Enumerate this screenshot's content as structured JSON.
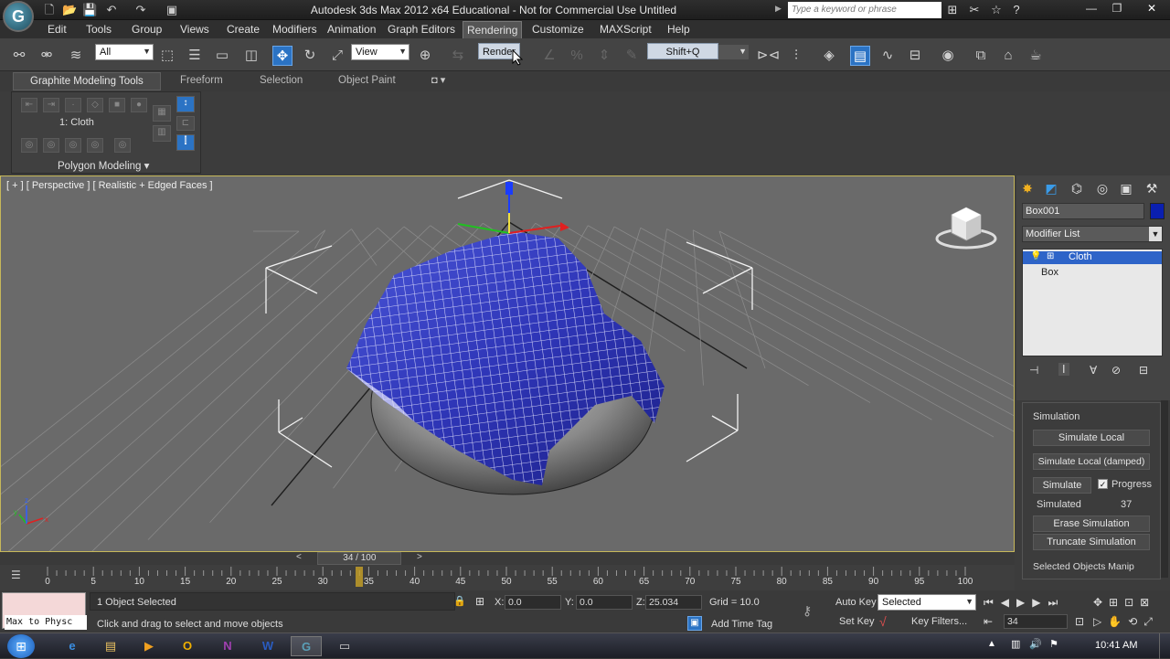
{
  "app": {
    "logo_glyph": "G",
    "window_title": "Autodesk 3ds Max  2012 x64   Educational - Not for Commercial Use   Untitled",
    "search_placeholder": "Type a keyword or phrase",
    "win_minimize": "—",
    "win_restore": "❐",
    "win_close": "✕"
  },
  "quick_access": [
    {
      "name": "new-file-icon",
      "glyph": "🗋"
    },
    {
      "name": "open-file-icon",
      "glyph": "📂"
    },
    {
      "name": "save-icon",
      "glyph": "💾"
    },
    {
      "name": "undo-icon",
      "glyph": "↶"
    },
    {
      "name": "redo-icon",
      "glyph": "↷"
    },
    {
      "name": "project-folder-icon",
      "glyph": "▣"
    }
  ],
  "title_icons": [
    {
      "name": "binoculars-icon",
      "glyph": "⊞"
    },
    {
      "name": "tools-icon",
      "glyph": "✂"
    },
    {
      "name": "star-icon",
      "glyph": "☆"
    },
    {
      "name": "help-icon",
      "glyph": "?"
    }
  ],
  "menu": [
    "Edit",
    "Tools",
    "Group",
    "Views",
    "Create",
    "Modifiers",
    "Animation",
    "Graph Editors",
    "Rendering",
    "Customize",
    "MAXScript",
    "Help"
  ],
  "toolbar": {
    "selection_filter": "All",
    "reference_coord": "View",
    "render_tooltip": "Render",
    "shortcut_tooltip": "Shift+Q"
  },
  "ribbon": {
    "tabs": [
      "Graphite Modeling Tools",
      "Freeform",
      "Selection",
      "Object Paint"
    ],
    "object_label": "1: Cloth",
    "panel_title": "Polygon Modeling"
  },
  "viewport": {
    "label": "[ + ] [ Perspective ] [ Realistic + Edged Faces ]",
    "axis_x": "x",
    "axis_y": "y",
    "axis_z": "z"
  },
  "command_panel": {
    "object_name": "Box001",
    "object_color": "#0a1fb0",
    "modifier_list": "Modifier List",
    "stack": [
      "Cloth",
      "Box"
    ],
    "rollout_title": "Simulation",
    "buttons": {
      "simulate_local": "Simulate Local",
      "simulate_local_damped": "Simulate Local (damped)",
      "simulate": "Simulate",
      "erase_simulation": "Erase Simulation",
      "truncate_simulation": "Truncate Simulation"
    },
    "progress_label": "Progress",
    "progress_checked": true,
    "simulated_label": "Simulated",
    "simulated_value": "37",
    "next_rollout": "Selected Objects Manip"
  },
  "timeline": {
    "frame_readout": "34 / 100",
    "current_frame": 34,
    "total_frames": 100,
    "ticks": [
      "0",
      "5",
      "10",
      "15",
      "20",
      "25",
      "30",
      "35",
      "40",
      "45",
      "50",
      "55",
      "60",
      "65",
      "70",
      "75",
      "80",
      "85",
      "90",
      "95",
      "100"
    ]
  },
  "status": {
    "listener_text": "Max to Physc",
    "selection": "1 Object Selected",
    "prompt": "Click and drag to select and move objects",
    "x_label": "X:",
    "x_value": "0.0",
    "y_label": "Y:",
    "y_value": "0.0",
    "z_label": "Z:",
    "z_value": "25.034",
    "grid": "Grid = 10.0",
    "add_time_tag": "Add Time Tag",
    "auto_key": "Auto Key",
    "set_key": "Set Key",
    "key_mode": "Selected",
    "key_filters": "Key Filters...",
    "frame_field": "34"
  },
  "taskbar": {
    "clock": "10:41 AM",
    "apps": [
      {
        "name": "internet-explorer-icon",
        "glyph": "e",
        "color": "#3a8de0"
      },
      {
        "name": "file-explorer-icon",
        "glyph": "▤",
        "color": "#e8c060"
      },
      {
        "name": "media-player-icon",
        "glyph": "▶",
        "color": "#f0a020"
      },
      {
        "name": "outlook-icon",
        "glyph": "O",
        "color": "#f0b000"
      },
      {
        "name": "onenote-icon",
        "glyph": "N",
        "color": "#a040b0"
      },
      {
        "name": "word-icon",
        "glyph": "W",
        "color": "#2a5cc0"
      },
      {
        "name": "3dsmax-icon",
        "glyph": "G",
        "color": "#5aa0b8"
      },
      {
        "name": "window-icon",
        "glyph": "▭",
        "color": "#ccc"
      }
    ]
  }
}
